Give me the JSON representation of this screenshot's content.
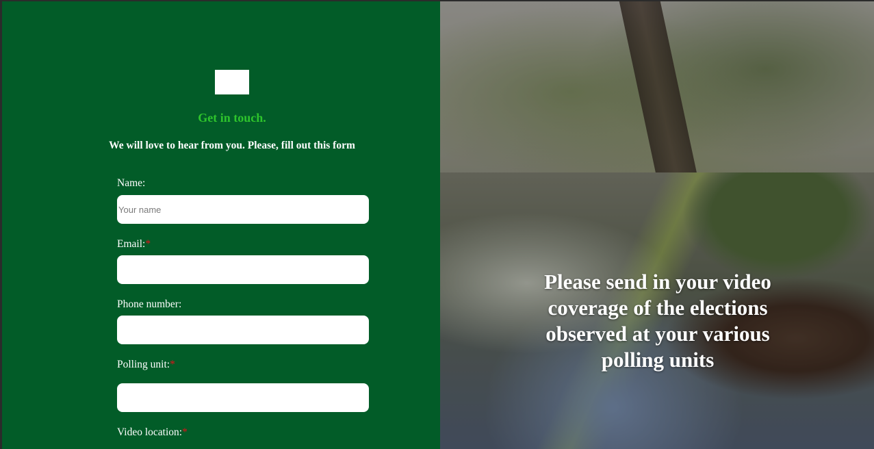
{
  "form": {
    "heading": "Get in touch.",
    "subheading": "We will love to hear from you. Please, fill out this form",
    "required_mark": "*",
    "fields": {
      "name": {
        "label": "Name:",
        "placeholder": "Your name",
        "value": ""
      },
      "email": {
        "label": "Email:",
        "value": ""
      },
      "phone": {
        "label": "Phone number:",
        "value": ""
      },
      "polling_unit": {
        "label": "Polling unit:",
        "value": ""
      },
      "video_location": {
        "label": "Video location:"
      }
    }
  },
  "hero": {
    "message": "Please send in your video coverage of the elections observed at your various polling units"
  },
  "colors": {
    "panel_bg": "#025c28",
    "heading": "#2ec42c",
    "required": "#e0121a"
  }
}
